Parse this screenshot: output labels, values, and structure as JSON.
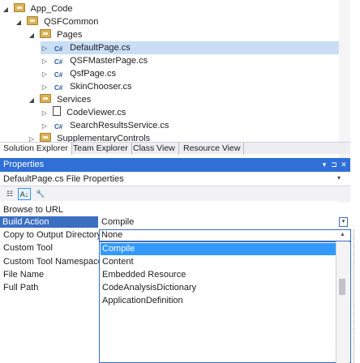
{
  "tree": {
    "items": [
      {
        "label": "App_Code",
        "arrow": "◢",
        "icon": "folder-icon"
      },
      {
        "label": "QSFCommon",
        "arrow": "◢",
        "icon": "folder-icon"
      },
      {
        "label": "Pages",
        "arrow": "◢",
        "icon": "folder-icon"
      },
      {
        "label": "DefaultPage.cs",
        "arrow": "▷",
        "icon": "csharp-file-icon",
        "cs": "C#"
      },
      {
        "label": "QSFMasterPage.cs",
        "arrow": "▷",
        "icon": "csharp-file-icon",
        "cs": "C#"
      },
      {
        "label": "QsfPage.cs",
        "arrow": "▷",
        "icon": "csharp-file-icon",
        "cs": "C#"
      },
      {
        "label": "SkinChooser.cs",
        "arrow": "▷",
        "icon": "csharp-file-icon",
        "cs": "C#"
      },
      {
        "label": "Services",
        "arrow": "◢",
        "icon": "folder-icon"
      },
      {
        "label": "CodeViewer.cs",
        "arrow": "▷",
        "icon": "page-file-icon"
      },
      {
        "label": "SearchResultsService.cs",
        "arrow": "▷",
        "icon": "csharp-file-icon",
        "cs": "C#"
      },
      {
        "label": "SupplementaryControls",
        "arrow": "▷",
        "icon": "folder-icon"
      }
    ]
  },
  "tabs": [
    {
      "label": "Solution Explorer"
    },
    {
      "label": "Team Explorer"
    },
    {
      "label": "Class View"
    },
    {
      "label": "Resource View"
    }
  ],
  "properties": {
    "title": "Properties",
    "pin": "▾",
    "pin2": "⊐",
    "close": "✕",
    "object_name": "DefaultPage.cs",
    "object_type": "File Properties",
    "object_dropdown": "▾",
    "toolbar": {
      "categorized": "☷",
      "alphabetical": "A↓",
      "property_pages": "🔧"
    },
    "rows": [
      {
        "name": "Browse to URL",
        "value": ""
      },
      {
        "name": "Build Action",
        "value": "Compile"
      },
      {
        "name": "Copy to Output Directory",
        "value": "None"
      },
      {
        "name": "Custom Tool",
        "value": ""
      },
      {
        "name": "Custom Tool Namespace",
        "value": ""
      },
      {
        "name": "File Name",
        "value": ""
      },
      {
        "name": "Full Path",
        "value": ""
      }
    ],
    "dropdown_options": [
      "Compile",
      "Content",
      "Embedded Resource",
      "CodeAnalysisDictionary",
      "ApplicationDefinition"
    ]
  }
}
